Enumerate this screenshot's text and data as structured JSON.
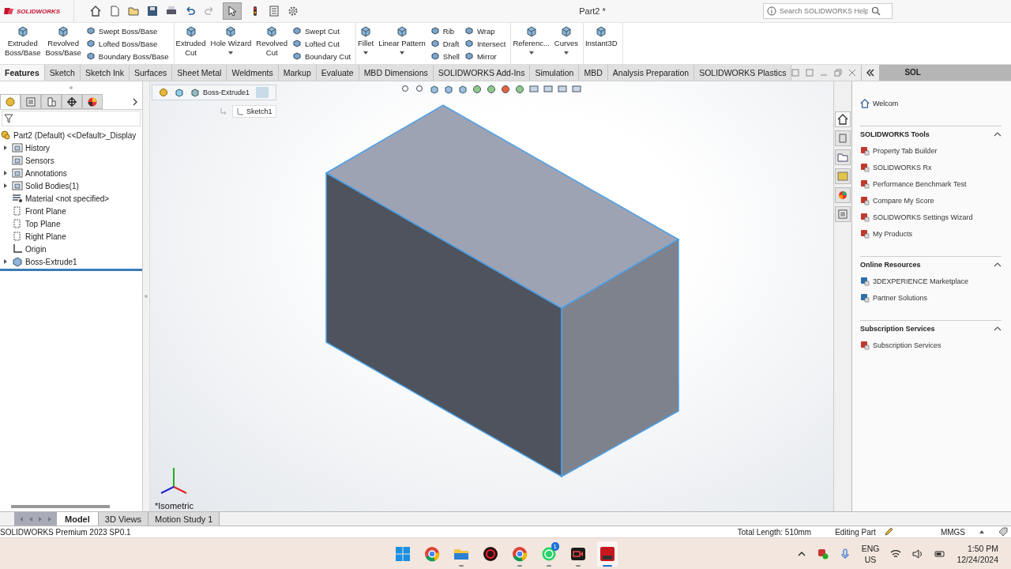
{
  "app": {
    "logo": "SOLIDWORKS",
    "title": "Part2 *",
    "search": {
      "placeholder": "Search SOLIDWORKS Help"
    },
    "select_pressed": true
  },
  "ribbon": [
    {
      "items": [
        {
          "kind": "large",
          "label": "Extruded\nBoss/Base",
          "dropdown": false
        },
        {
          "kind": "large",
          "label": "Revolved\nBoss/Base",
          "dropdown": false
        },
        {
          "kind": "stack",
          "items": [
            "Swept Boss/Base",
            "Lofted Boss/Base",
            "Boundary Boss/Base"
          ]
        }
      ]
    },
    {
      "items": [
        {
          "kind": "large",
          "label": "Extruded\nCut",
          "dropdown": false
        },
        {
          "kind": "large",
          "label": "Hole Wizard",
          "dropdown": true
        },
        {
          "kind": "large",
          "label": "Revolved\nCut",
          "dropdown": false
        },
        {
          "kind": "stack",
          "items": [
            "Swept Cut",
            "Lofted Cut",
            "Boundary Cut"
          ]
        }
      ]
    },
    {
      "items": [
        {
          "kind": "large",
          "label": "Fillet",
          "dropdown": true
        },
        {
          "kind": "large",
          "label": "Linear Pattern",
          "dropdown": true
        },
        {
          "kind": "stack",
          "items": [
            "Rib",
            "Draft",
            "Shell"
          ]
        },
        {
          "kind": "stack",
          "items": [
            "Wrap",
            "Intersect",
            "Mirror"
          ]
        }
      ]
    },
    {
      "items": [
        {
          "kind": "large",
          "label": "Referenc...",
          "dropdown": true
        },
        {
          "kind": "large",
          "label": "Curves",
          "dropdown": true
        }
      ]
    },
    {
      "items": [
        {
          "kind": "large",
          "label": "Instant3D",
          "dropdown": false
        }
      ]
    }
  ],
  "tabs": [
    {
      "label": "Features",
      "selected": true
    },
    {
      "label": "Sketch",
      "selected": false
    },
    {
      "label": "Sketch Ink",
      "selected": false
    },
    {
      "label": "Surfaces",
      "selected": false
    },
    {
      "label": "Sheet Metal",
      "selected": false
    },
    {
      "label": "Weldments",
      "selected": false
    },
    {
      "label": "Markup",
      "selected": false
    },
    {
      "label": "Evaluate",
      "selected": false
    },
    {
      "label": "MBD Dimensions",
      "selected": false
    },
    {
      "label": "SOLIDWORKS Add-Ins",
      "selected": false
    },
    {
      "label": "Simulation",
      "selected": false
    },
    {
      "label": "MBD",
      "selected": false
    },
    {
      "label": "Analysis Preparation",
      "selected": false
    },
    {
      "label": "SOLIDWORKS Plastics",
      "selected": false
    }
  ],
  "feature_manager": {
    "tabs": [
      {
        "selected": true
      },
      {
        "selected": false
      },
      {
        "selected": false
      },
      {
        "selected": false
      },
      {
        "selected": false
      }
    ],
    "tree": {
      "label": "Part2 (Default) <<Default>_Display",
      "children": [
        {
          "label": "History",
          "kind": "folder",
          "expanded": false
        },
        {
          "label": "Sensors",
          "kind": "folder"
        },
        {
          "label": "Annotations",
          "kind": "folder",
          "expanded": false
        },
        {
          "label": "Solid Bodies(1)",
          "kind": "folder",
          "expanded": false
        },
        {
          "label": "Material <not specified>",
          "kind": "material"
        },
        {
          "label": "Front Plane",
          "kind": "plane"
        },
        {
          "label": "Top Plane",
          "kind": "plane"
        },
        {
          "label": "Right Plane",
          "kind": "plane"
        },
        {
          "label": "Origin",
          "kind": "origin"
        },
        {
          "label": "Boss-Extrude1",
          "kind": "feature",
          "expanded": false
        }
      ]
    }
  },
  "viewport": {
    "breadcrumb": "Boss-Extrude1",
    "sketch": "Sketch1",
    "view_label": "*Isometric"
  },
  "bottom_tabs": [
    {
      "label": "Model",
      "selected": true
    },
    {
      "label": "3D Views",
      "selected": false
    },
    {
      "label": "Motion Study 1",
      "selected": false
    }
  ],
  "status_bar": {
    "product": "SOLIDWORKS Premium 2023 SP0.1",
    "items": [
      "Total Length: 510mm",
      "Editing Part",
      "MMGS"
    ]
  },
  "task_pane": {
    "header": "SOL",
    "welcome": "Welcom",
    "sections": [
      {
        "title": "SOLIDWORKS Tools",
        "expanded": true,
        "items": [
          "Property Tab Builder",
          "SOLIDWORKS Rx",
          "Performance Benchmark Test",
          "Compare My Score",
          "SOLIDWORKS Settings Wizard",
          "My Products"
        ]
      },
      {
        "title": "Online Resources",
        "expanded": true,
        "items": [
          "3DEXPERIENCE Marketplace",
          "Partner Solutions"
        ]
      },
      {
        "title": "Subscription Services",
        "expanded": true,
        "items": [
          "Subscription Services"
        ]
      }
    ]
  },
  "taskbar": {
    "apps": [
      {
        "kind": "start",
        "running": false,
        "active": false
      },
      {
        "kind": "browser",
        "running": false,
        "active": false
      },
      {
        "kind": "folder",
        "running": true,
        "active": false
      },
      {
        "kind": "red-app",
        "running": false,
        "active": false
      },
      {
        "kind": "browser",
        "running": true,
        "active": false
      },
      {
        "kind": "chat",
        "running": true,
        "active": false,
        "badge": "1"
      },
      {
        "kind": "video",
        "running": true,
        "active": false
      },
      {
        "kind": "sw",
        "running": true,
        "active": true
      }
    ],
    "language": [
      "ENG",
      "US"
    ],
    "time": "1:50 PM",
    "date": "12/24/2024"
  }
}
